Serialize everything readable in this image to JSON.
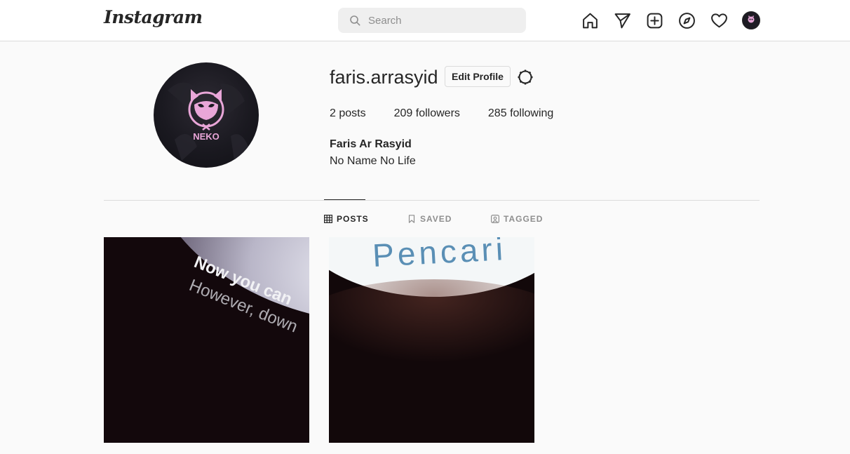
{
  "header": {
    "logo_text": "Instagram",
    "search": {
      "placeholder": "Search",
      "value": ""
    },
    "nav_icons": [
      "home-icon",
      "direct-icon",
      "new-post-icon",
      "explore-icon",
      "activity-icon",
      "profile-avatar"
    ]
  },
  "profile": {
    "username": "faris.arrasyid",
    "edit_button": "Edit Profile",
    "stats": {
      "posts_count": "2",
      "posts_label": "posts",
      "followers_count": "209",
      "followers_label": "followers",
      "following_count": "285",
      "following_label": "following"
    },
    "full_name": "Faris Ar Rasyid",
    "bio": "No Name No Life",
    "avatar_logo_text": "NEKO"
  },
  "tabs": [
    {
      "label": "POSTS",
      "active": true,
      "icon": "grid-icon"
    },
    {
      "label": "SAVED",
      "active": false,
      "icon": "bookmark-icon"
    },
    {
      "label": "TAGGED",
      "active": false,
      "icon": "tagged-icon"
    }
  ],
  "posts": [
    {
      "text_lines": [
        "Now you can",
        "However, down"
      ]
    },
    {
      "text_lines": [
        "Pencari"
      ]
    }
  ],
  "colors": {
    "text": "#262626",
    "secondary_text": "#8e8e8e",
    "border": "#dbdbdb",
    "background": "#fafafa",
    "avatar_accent": "#e9a6d8"
  }
}
